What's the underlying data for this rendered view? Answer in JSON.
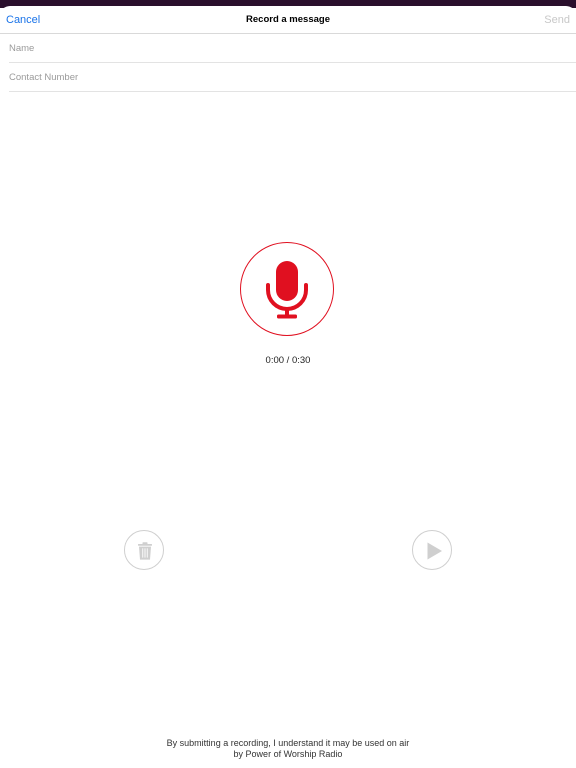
{
  "header": {
    "cancel_label": "Cancel",
    "title": "Record a message",
    "send_label": "Send"
  },
  "form": {
    "name_placeholder": "Name",
    "name_value": "",
    "contact_placeholder": "Contact Number",
    "contact_value": ""
  },
  "recorder": {
    "icon": "microphone-icon",
    "timer": "0:00 / 0:30",
    "accent_color": "#e01020"
  },
  "controls": {
    "delete_icon": "trash-icon",
    "play_icon": "play-icon"
  },
  "footer": {
    "disclaimer_line1": "By submitting a recording, I understand it may be used on air",
    "disclaimer_line2": "by Power of Worship Radio"
  },
  "colors": {
    "link": "#1a73e8",
    "disabled": "#c8c8c8",
    "top_strip": "#2a0f2c"
  }
}
